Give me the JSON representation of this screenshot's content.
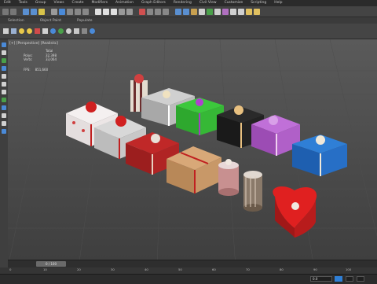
{
  "menubar": {
    "items": [
      "Edit",
      "Tools",
      "Group",
      "Views",
      "Create",
      "Modifiers",
      "Animation",
      "Graph Editors",
      "Rendering",
      "Civil View",
      "Customize",
      "Scripting",
      "Help"
    ]
  },
  "ribbon": {
    "tabs": [
      "Selection",
      "Object Paint",
      "Populate"
    ]
  },
  "viewport": {
    "label": "[+] [Perspective] [Realistic]",
    "stats": [
      {
        "key": "",
        "value": "Total"
      },
      {
        "key": "Polys:",
        "value": "32,398"
      },
      {
        "key": "Verts:",
        "value": "33,064"
      }
    ],
    "fps_key": "FPS:",
    "fps_value": "851,660"
  },
  "timeline": {
    "slider_label": "0 / 100",
    "ticks": [
      "0",
      "10",
      "20",
      "30",
      "40",
      "50",
      "60",
      "70",
      "80",
      "90",
      "100"
    ]
  },
  "statusbar": {
    "coord_value": "0.0"
  },
  "colors": {
    "background": "#3a3a3a",
    "viewport_top": "#5a5a5a",
    "viewport_bottom": "#3e3e3e",
    "accent_blue": "#2f7fd6"
  }
}
